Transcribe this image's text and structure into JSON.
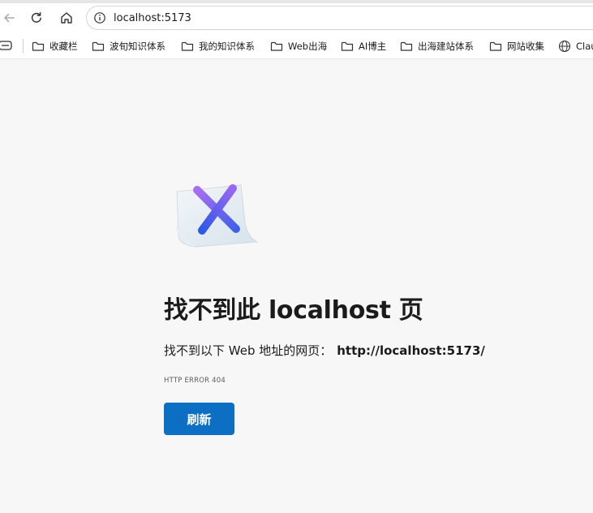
{
  "address_bar": {
    "url": "localhost:5173"
  },
  "bookmarks": [
    {
      "label": "收藏栏",
      "icon": "folder-icon"
    },
    {
      "label": "波旬知识体系",
      "icon": "folder-icon"
    },
    {
      "label": "我的知识体系",
      "icon": "folder-icon"
    },
    {
      "label": "Web出海",
      "icon": "folder-icon"
    },
    {
      "label": "AI博主",
      "icon": "folder-icon"
    },
    {
      "label": "出海建站体系",
      "icon": "folder-icon"
    },
    {
      "label": "网站收集",
      "icon": "folder-icon"
    },
    {
      "label": "Clau",
      "icon": "globe-icon"
    }
  ],
  "error": {
    "title": "找不到此 localhost 页",
    "subtitle_prefix": "找不到以下 Web 地址的网页：",
    "url": "http://localhost:5173/",
    "code": "HTTP ERROR 404",
    "refresh_label": "刷新"
  },
  "colors": {
    "accent": "#0c6fc4",
    "page_bg": "#f7f7f7",
    "illustration_x_from": "#8b5cf6",
    "illustration_x_to": "#2563eb"
  }
}
